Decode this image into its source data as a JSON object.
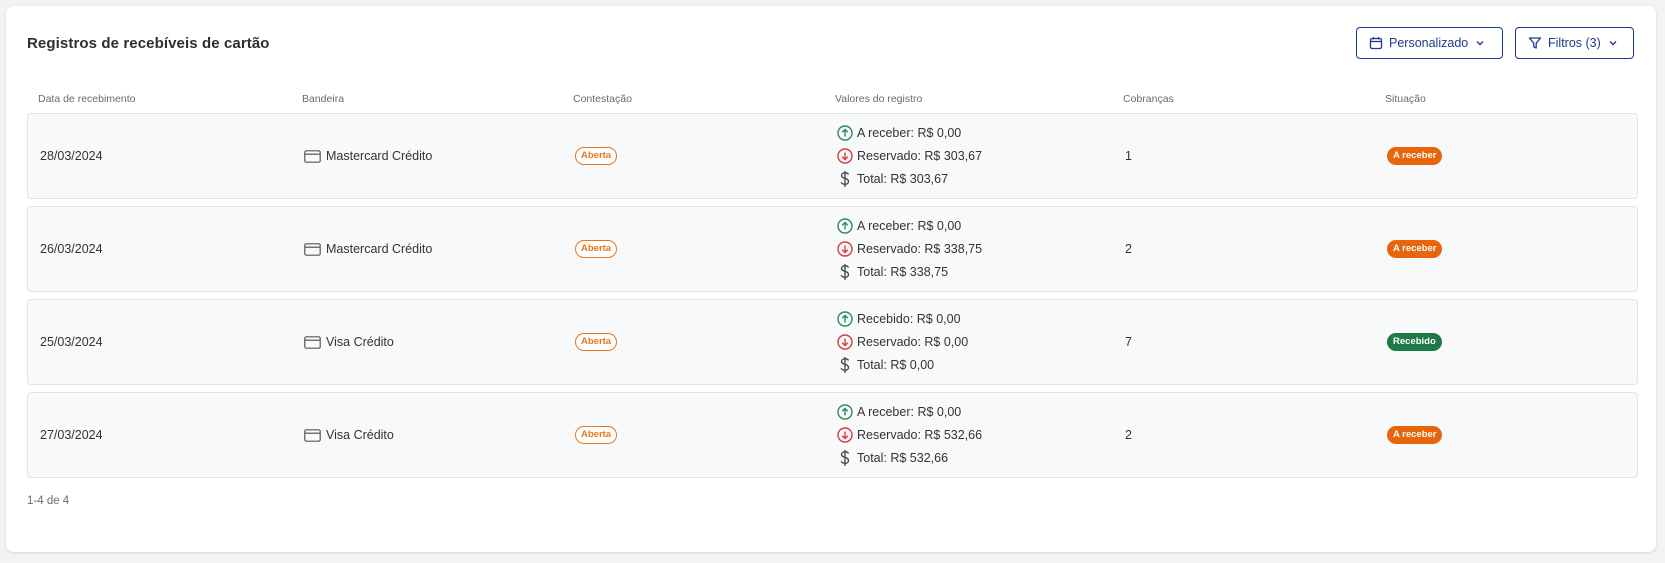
{
  "page": {
    "title": "Registros de recebíveis de cartão",
    "period_button": "Personalizado",
    "filter_button": "Filtros (3)"
  },
  "columns": [
    "Data de recebimento",
    "Bandeira",
    "Contestação",
    "Valores do registro",
    "Cobranças",
    "Situação"
  ],
  "rows": [
    {
      "date": "28/03/2024",
      "brand": "Mastercard Crédito",
      "dispute": "Aberta",
      "line1": "A receber: R$ 0,00",
      "line2": "Reservado: R$ 303,67",
      "line3": "Total: R$ 303,67",
      "charges": "1",
      "status": "A receber",
      "status_color": "#e8650c"
    },
    {
      "date": "26/03/2024",
      "brand": "Mastercard Crédito",
      "dispute": "Aberta",
      "line1": "A receber: R$ 0,00",
      "line2": "Reservado: R$ 338,75",
      "line3": "Total: R$ 338,75",
      "charges": "2",
      "status": "A receber",
      "status_color": "#e8650c"
    },
    {
      "date": "25/03/2024",
      "brand": "Visa Crédito",
      "dispute": "Aberta",
      "line1": "Recebido: R$ 0,00",
      "line2": "Reservado: R$ 0,00",
      "line3": "Total: R$ 0,00",
      "charges": "7",
      "status": "Recebido",
      "status_color": "#1c7a45"
    },
    {
      "date": "27/03/2024",
      "brand": "Visa Crédito",
      "dispute": "Aberta",
      "line1": "A receber: R$ 0,00",
      "line2": "Reservado: R$ 532,66",
      "line3": "Total: R$ 532,66",
      "charges": "2",
      "status": "A receber",
      "status_color": "#e8650c"
    }
  ],
  "pagination": "1-4 de 4",
  "colors": {
    "accent": "#1d3a8a",
    "up": "#2e8b57",
    "down": "#d93b3b",
    "dispute": "#e8761c"
  }
}
